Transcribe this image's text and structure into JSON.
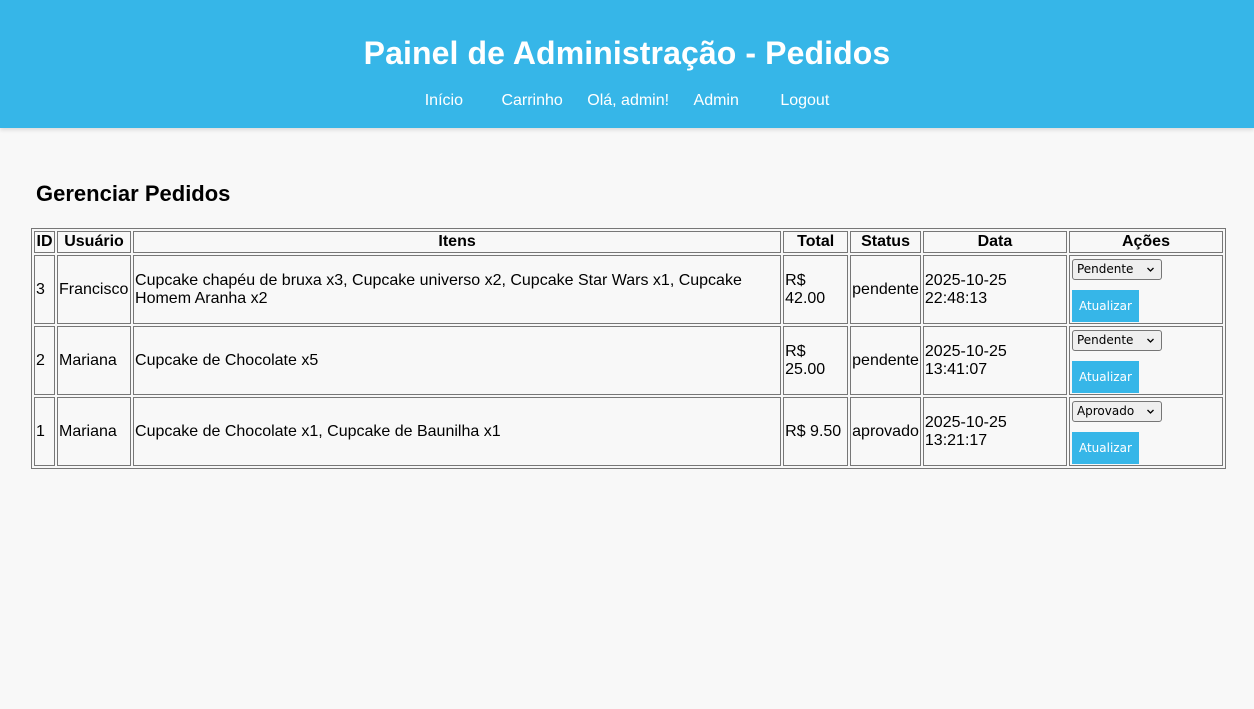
{
  "header": {
    "title": "Painel de Administração - Pedidos",
    "nav": {
      "inicio": "Início",
      "carrinho": "Carrinho",
      "greeting": "Olá, admin!",
      "admin": "Admin",
      "logout": "Logout"
    }
  },
  "main": {
    "heading": "Gerenciar Pedidos",
    "table": {
      "headers": {
        "id": "ID",
        "usuario": "Usuário",
        "itens": "Itens",
        "total": "Total",
        "status": "Status",
        "data": "Data",
        "acoes": "Ações"
      },
      "rows": [
        {
          "id": "3",
          "usuario": "Francisco",
          "itens": "Cupcake chapéu de bruxa x3, Cupcake universo x2, Cupcake Star Wars x1, Cupcake Homem Aranha x2",
          "total": "R$ 42.00",
          "status": "pendente",
          "data": "2025-10-25 22:48:13",
          "select_value": "Pendente",
          "button": "Atualizar"
        },
        {
          "id": "2",
          "usuario": "Mariana",
          "itens": "Cupcake de Chocolate x5",
          "total": "R$ 25.00",
          "status": "pendente",
          "data": "2025-10-25 13:41:07",
          "select_value": "Pendente",
          "button": "Atualizar"
        },
        {
          "id": "1",
          "usuario": "Mariana",
          "itens": "Cupcake de Chocolate x1, Cupcake de Baunilha x1",
          "total": "R$ 9.50",
          "status": "aprovado",
          "data": "2025-10-25 13:21:17",
          "select_value": "Aprovado",
          "button": "Atualizar"
        }
      ]
    }
  },
  "icons": {
    "select_arrow": "chevron-down-icon"
  },
  "colors": {
    "header_bg": "#36b6e8",
    "button_bg": "#36b6e8",
    "page_bg": "#f8f8f8"
  }
}
